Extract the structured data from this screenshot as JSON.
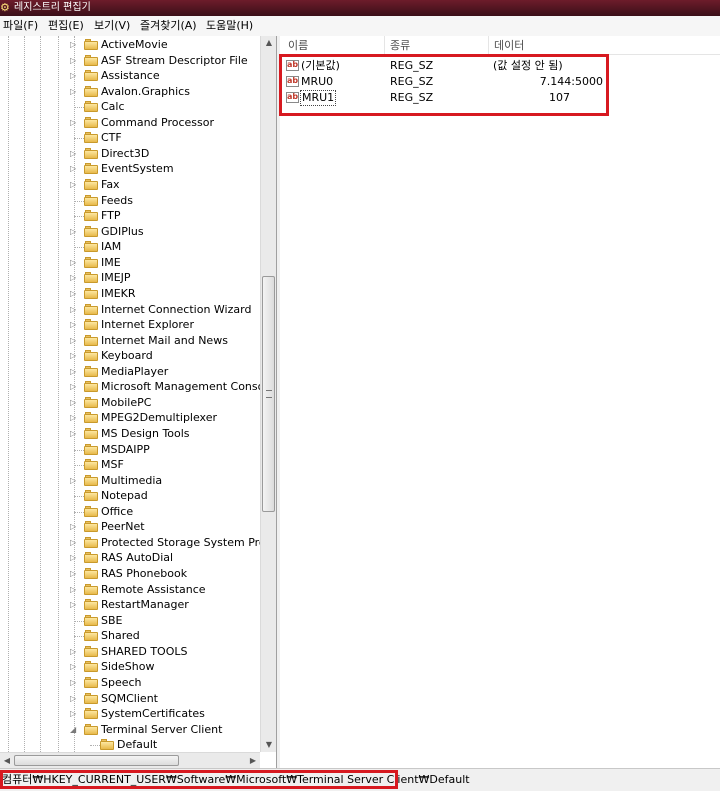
{
  "window": {
    "title": "레지스트리 편집기"
  },
  "menu": [
    "파일(F)",
    "편집(E)",
    "보기(V)",
    "즐겨찾기(A)",
    "도움말(H)"
  ],
  "tree": {
    "items": [
      "ActiveMovie",
      "ASF Stream Descriptor File",
      "Assistance",
      "Avalon.Graphics",
      "Calc",
      "Command Processor",
      "CTF",
      "Direct3D",
      "EventSystem",
      "Fax",
      "Feeds",
      "FTP",
      "GDIPlus",
      "IAM",
      "IME",
      "IMEJP",
      "IMEKR",
      "Internet Connection Wizard",
      "Internet Explorer",
      "Internet Mail and News",
      "Keyboard",
      "MediaPlayer",
      "Microsoft Management Console",
      "MobilePC",
      "MPEG2Demultiplexer",
      "MS Design Tools",
      "MSDAIPP",
      "MSF",
      "Multimedia",
      "Notepad",
      "Office",
      "PeerNet",
      "Protected Storage System Provider",
      "RAS AutoDial",
      "RAS Phonebook",
      "Remote Assistance",
      "RestartManager",
      "SBE",
      "Shared",
      "SHARED TOOLS",
      "SideShow",
      "Speech",
      "SQMClient",
      "SystemCertificates",
      "Terminal Server Client"
    ],
    "selected_child": "Default"
  },
  "list": {
    "columns": {
      "name": "이름",
      "type": "종류",
      "data": "데이터"
    },
    "rows": [
      {
        "name": "(기본값)",
        "type": "REG_SZ",
        "data": "(값 설정 안 됨)",
        "icon": "ab"
      },
      {
        "name": "MRU0",
        "type": "REG_SZ",
        "data": "7.144:5000",
        "icon": "ab"
      },
      {
        "name": "MRU1",
        "type": "REG_SZ",
        "data": "107",
        "icon": "ab"
      }
    ]
  },
  "status": {
    "path": "컴퓨터₩HKEY_CURRENT_USER₩Software₩Microsoft₩Terminal Server Client₩Default"
  },
  "colors": {
    "highlight": "#d71920",
    "title_bar": "#6d1c2b"
  }
}
